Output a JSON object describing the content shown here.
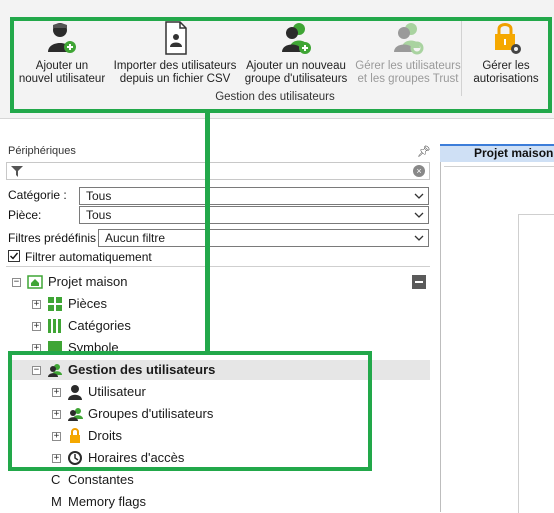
{
  "ribbon": {
    "buttons": [
      {
        "label_l1": "Ajouter un",
        "label_l2": "nouvel utilisateur",
        "icon": "add-user-icon",
        "enabled": true
      },
      {
        "label_l1": "Importer des utilisateurs",
        "label_l2": "depuis un fichier CSV",
        "icon": "import-csv-icon",
        "enabled": true
      },
      {
        "label_l1": "Ajouter un nouveau",
        "label_l2": "groupe d'utilisateurs",
        "icon": "add-group-icon",
        "enabled": true
      },
      {
        "label_l1": "Gérer les utilisateurs",
        "label_l2": "et les groupes Trust",
        "icon": "manage-trust-icon",
        "enabled": false
      },
      {
        "label_l1": "Gérer les",
        "label_l2": "autorisations",
        "icon": "lock-gear-icon",
        "enabled": true
      }
    ],
    "group_caption": "Gestion des utilisateurs"
  },
  "panel": {
    "title": "Périphériques",
    "pin": "ᵖ",
    "filter": {
      "placeholder": "",
      "clear": "×"
    },
    "category_label": "Catégorie :",
    "category_value": "Tous",
    "room_label": "Pièce:",
    "room_value": "Tous",
    "predefined_label": "Filtres prédéfinis",
    "predefined_value": "Aucun filtre",
    "auto_filter_label": "Filtrer automatiquement",
    "auto_filter_checked": true
  },
  "tree": {
    "root": "Projet maison",
    "items": [
      {
        "label": "Pièces"
      },
      {
        "label": "Catégories"
      },
      {
        "label": "Symbole"
      },
      {
        "label": "Gestion des utilisateurs"
      },
      {
        "label": "Utilisateur"
      },
      {
        "label": "Groupes d'utilisateurs"
      },
      {
        "label": "Droits"
      },
      {
        "label": "Horaires d'accès"
      },
      {
        "label": "Constantes",
        "prefix": "C"
      },
      {
        "label": "Memory flags",
        "prefix": "M"
      }
    ]
  },
  "document": {
    "tab": "Projet maison"
  },
  "colors": {
    "highlight": "#22a84a",
    "selection": "#e6e6e6",
    "tab_accent": "#3c7dd9"
  }
}
